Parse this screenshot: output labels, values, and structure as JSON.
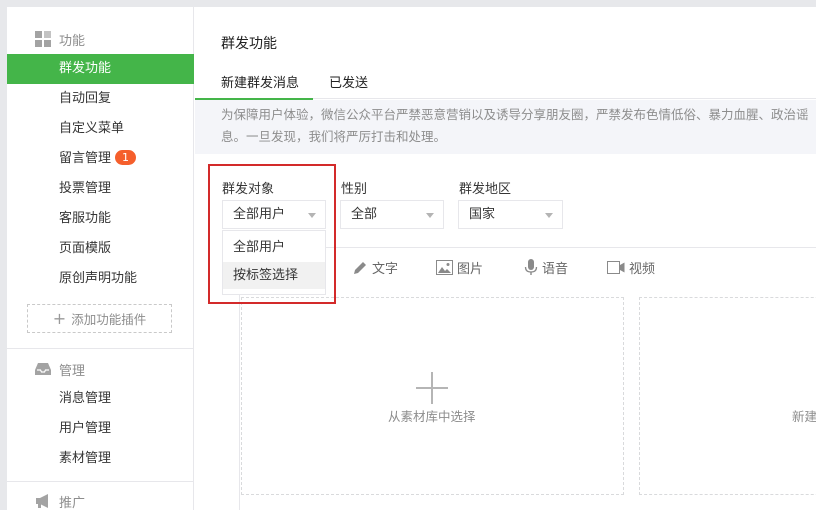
{
  "sidebar": {
    "groups": [
      {
        "title": "功能",
        "icon": "grid-icon"
      },
      {
        "title": "管理",
        "icon": "inbox-icon"
      },
      {
        "title": "推广",
        "icon": "megaphone-icon"
      }
    ],
    "function_items": [
      "群发功能",
      "自动回复",
      "自定义菜单",
      "留言管理",
      "投票管理",
      "客服功能",
      "页面模版",
      "原创声明功能"
    ],
    "message_badge": "1",
    "add_plugin": "添加功能插件",
    "manage_items": [
      "消息管理",
      "用户管理",
      "素材管理"
    ]
  },
  "main": {
    "title": "群发功能",
    "tabs": [
      "新建群发消息",
      "已发送"
    ],
    "notice_line1": "为保障用户体验，微信公众平台严禁恶意营销以及诱导分享朋友圈，严禁发布色情低俗、暴力血腥、政治谣",
    "notice_line2": "息。一旦发现，我们将严厉打击和处理。",
    "filters": {
      "target_label": "群发对象",
      "target_value": "全部用户",
      "gender_label": "性别",
      "gender_value": "全部",
      "region_label": "群发地区",
      "region_value": "国家"
    },
    "dropdown_options": [
      "全部用户",
      "按标签选择"
    ],
    "toolbar": [
      "文字",
      "图片",
      "语音",
      "视频"
    ],
    "card_left": "从素材库中选择",
    "card_right": "新建"
  },
  "colors": {
    "accent": "#44b549",
    "badge": "#f55f2c",
    "highlight": "#d32a2a"
  }
}
